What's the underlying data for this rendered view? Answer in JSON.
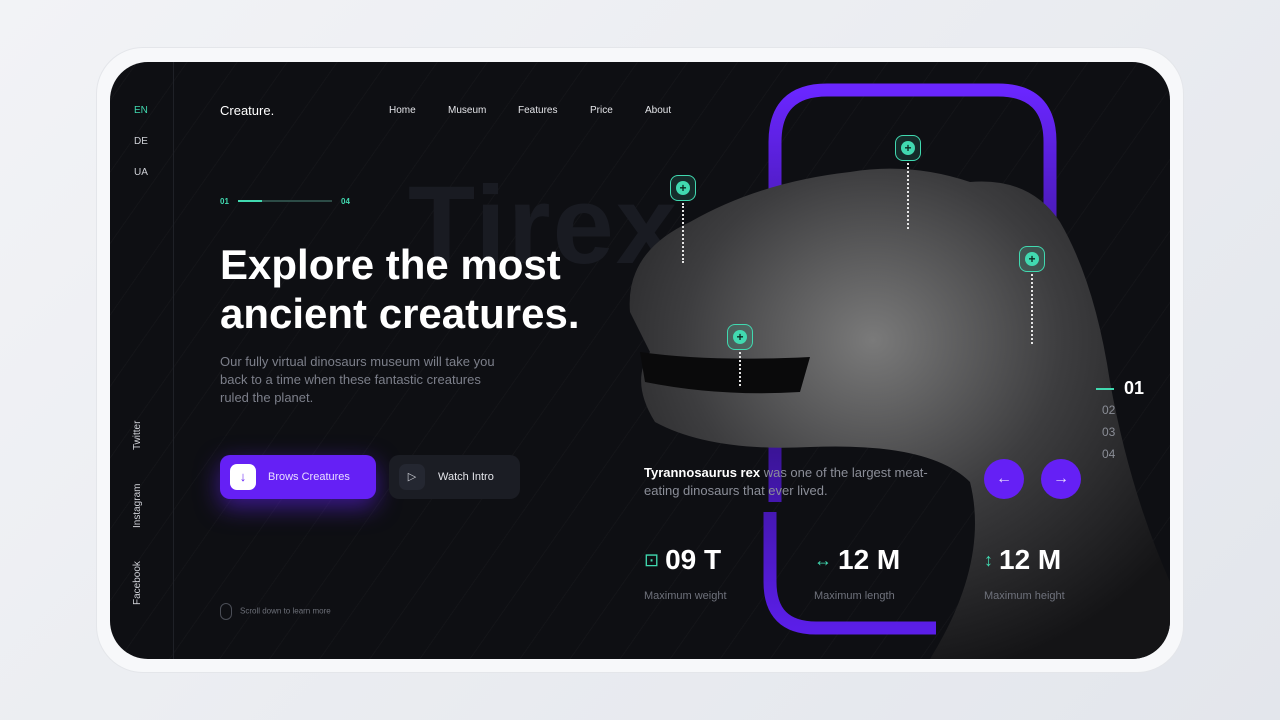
{
  "brand": "Creature.",
  "languages": [
    {
      "label": "EN",
      "active": true
    },
    {
      "label": "DE"
    },
    {
      "label": "UA"
    }
  ],
  "social": [
    "Twitter",
    "Instagram",
    "Facebook"
  ],
  "nav": [
    "Home",
    "Museum",
    "Features",
    "Price",
    "About"
  ],
  "progress": {
    "current": "01",
    "total": "04",
    "fraction": 0.25
  },
  "ghost_title": "Tirex",
  "hero": {
    "title": "Explore the most ancient creatures.",
    "description": "Our fully virtual dinosaurs museum will take you back to a time when these fantastic creatures ruled the planet."
  },
  "buttons": {
    "browse": "Brows Creatures",
    "watch": "Watch Intro"
  },
  "scroll_hint": "Scroll down to learn more",
  "fact": {
    "name": "Tyrannosaurus rex",
    "text": " was one of the largest meat-eating dinosaurs that ever lived."
  },
  "slides": [
    "01",
    "02",
    "03",
    "04"
  ],
  "stats": [
    {
      "value": "09 T",
      "label": "Maximum weight",
      "icon": "scale-icon"
    },
    {
      "value": "12 M",
      "label": "Maximum length",
      "icon": "horizontal-arrows-icon"
    },
    {
      "value": "12 M",
      "label": "Maximum height",
      "icon": "vertical-arrows-icon"
    }
  ],
  "colors": {
    "accent": "#6520f5",
    "teal": "#41d9b0",
    "background": "#0e0f13"
  }
}
